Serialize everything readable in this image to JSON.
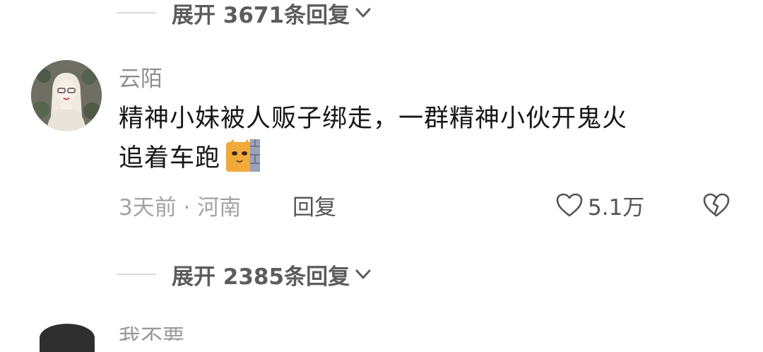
{
  "top_expand": {
    "label": "展开 3671条回复"
  },
  "comment": {
    "username": "云陌",
    "text_line1": "精神小妹被人贩子绑走，一群精神小伙开鬼火",
    "text_line2": "追着车跑",
    "emoji": "cat-peeking-icon",
    "time_location": "3天前 · 河南",
    "reply_label": "回复",
    "like_count": "5.1万"
  },
  "second_expand": {
    "label": "展开 2385条回复"
  },
  "next_comment": {
    "username_partial": "我不要"
  },
  "colors": {
    "text_primary": "#161616",
    "text_secondary": "#8f8f8f",
    "text_meta": "#a3a3a3",
    "expand_text": "#5c5c5c",
    "divider": "#d9d9d9",
    "emoji_cat": "#f2a93b"
  }
}
